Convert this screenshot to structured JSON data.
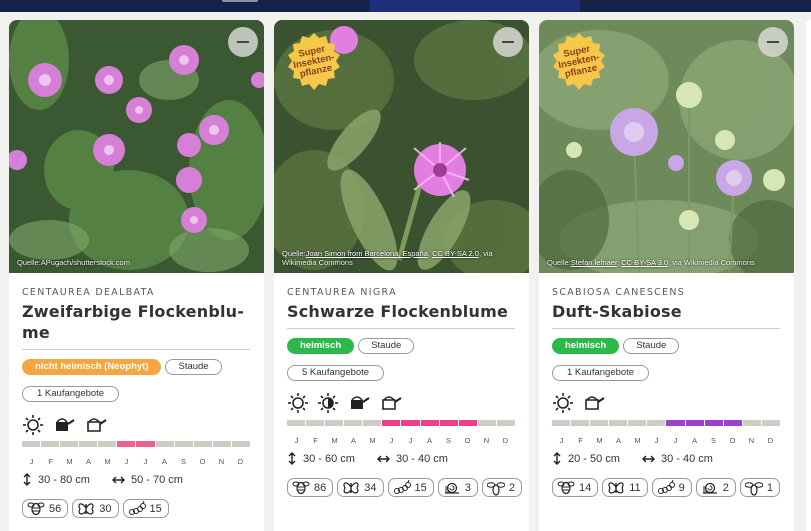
{
  "month_letters": [
    "J",
    "F",
    "M",
    "A",
    "M",
    "J",
    "J",
    "A",
    "S",
    "O",
    "N",
    "D"
  ],
  "cards": [
    {
      "latin": "CENTAUREA DEALBATA",
      "name": "Zweifarbige Flockenblu-me",
      "name_lines": [
        "Zweifarbige Flockenblu-",
        "me"
      ],
      "super_badge": null,
      "credit_prefix": "Quelle:",
      "credit": "APugach/shutterstock.com",
      "native_tag": "nicht heimisch (Neophyt)",
      "type_tag": "Staude",
      "kauf": "1 Kaufangebote",
      "icons": [
        "sun-icon",
        "watering-can-full-icon",
        "watering-can-empty-icon"
      ],
      "bloom_months": [
        6,
        7
      ],
      "bloom_color": "#ee5f93",
      "height": "30 - 80 cm",
      "width": "50 - 70 cm",
      "stats": [
        {
          "icon": "bee-icon",
          "value": "56"
        },
        {
          "icon": "butterfly-icon",
          "value": "30"
        },
        {
          "icon": "caterpillar-icon",
          "value": "15"
        }
      ]
    },
    {
      "latin": "CENTAUREA NIGRA",
      "name": "Schwarze Flockenblume",
      "name_lines": [
        "Schwarze Flockenblume"
      ],
      "super_badge": "Super Insekten-pflanze",
      "credit_prefix": "Quelle:",
      "credit_link_1": "Joan Simon from Barcelona, España",
      "credit_sep": ", ",
      "credit_link_2": "CC BY-SA 2.0",
      "credit_suffix": ", via Wikimedia Commons",
      "native_tag": "heimisch",
      "type_tag": "Staude",
      "kauf": "5 Kaufangebote",
      "icons": [
        "sun-icon",
        "half-shade-icon",
        "watering-can-full-icon",
        "watering-can-empty-icon"
      ],
      "bloom_months": [
        6,
        7,
        8,
        9,
        10
      ],
      "bloom_color": "#ee3f8a",
      "height": "30 - 60 cm",
      "width": "30 - 40 cm",
      "stats": [
        {
          "icon": "bee-icon",
          "value": "86"
        },
        {
          "icon": "butterfly-icon",
          "value": "34"
        },
        {
          "icon": "caterpillar-icon",
          "value": "15"
        },
        {
          "icon": "snail-icon",
          "value": "3"
        },
        {
          "icon": "hoverfly-icon",
          "value": "2"
        }
      ]
    },
    {
      "latin": "SCABIOSA CANESCENS",
      "name": "Duft-Skabiose",
      "name_lines": [
        "Duft-Skabiose"
      ],
      "super_badge": "Super Insekten-pflanze",
      "credit_prefix": "Quelle:",
      "credit_link_1": "Stefan.lefnaer",
      "credit_sep": ", ",
      "credit_link_2": "CC BY-SA 3.0",
      "credit_suffix": ", via Wikimedia Commons",
      "native_tag": "heimisch",
      "type_tag": "Staude",
      "kauf": "1 Kaufangebote",
      "icons": [
        "sun-icon",
        "watering-can-empty-icon"
      ],
      "bloom_months": [
        7,
        8,
        9,
        10
      ],
      "bloom_color": "#9a3fd0",
      "height": "20 - 50 cm",
      "width": "30 - 40 cm",
      "stats": [
        {
          "icon": "bee-icon",
          "value": "14"
        },
        {
          "icon": "butterfly-icon",
          "value": "11"
        },
        {
          "icon": "caterpillar-icon",
          "value": "9"
        },
        {
          "icon": "snail-icon",
          "value": "2"
        },
        {
          "icon": "hoverfly-icon",
          "value": "1"
        }
      ]
    }
  ]
}
